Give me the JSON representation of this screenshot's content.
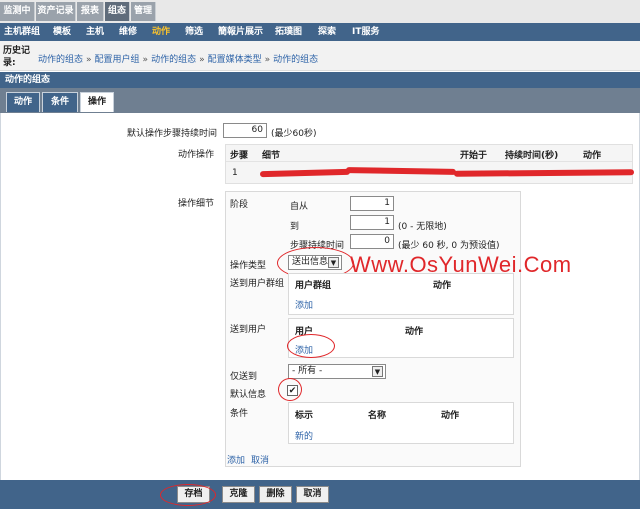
{
  "topnav": {
    "tabs": [
      {
        "label": "监测中"
      },
      {
        "label": "资产记录"
      },
      {
        "label": "报表"
      },
      {
        "label": "组态",
        "active": true
      },
      {
        "label": "管理"
      }
    ]
  },
  "subnav": {
    "items": [
      {
        "label": "主机群组"
      },
      {
        "label": "模板"
      },
      {
        "label": "主机"
      },
      {
        "label": "维修"
      },
      {
        "label": "动作",
        "active": true
      },
      {
        "label": "筛选"
      },
      {
        "label": "簡報片展示"
      },
      {
        "label": "拓璞图"
      },
      {
        "label": "探索"
      },
      {
        "label": "IT服务"
      }
    ]
  },
  "history": {
    "label": "历史记录:",
    "crumbs": [
      "动作的组态",
      "配置用户组",
      "动作的组态",
      "配置媒体类型",
      "动作的组态"
    ],
    "separator": "»"
  },
  "section_title": "动作的组态",
  "tabs": [
    {
      "label": "动作"
    },
    {
      "label": "条件"
    },
    {
      "label": "操作",
      "active": true
    }
  ],
  "form": {
    "default_step_duration": {
      "label": "默认操作步骤持续时间",
      "value": "60",
      "hint": "(最少60秒)"
    },
    "operations": {
      "label": "动作操作",
      "headers": {
        "step": "步骤",
        "detail": "细节",
        "start": "开始于",
        "duration": "持续时间(秒)",
        "action": "动作"
      },
      "row": {
        "step": "1"
      }
    },
    "op_details": {
      "label": "操作细节",
      "stage": {
        "label": "阶段",
        "from_label": "自从",
        "from_value": "1",
        "to_label": "到",
        "to_value": "1",
        "to_hint": "(0 - 无限地)",
        "duration_label": "步骤持续时间",
        "duration_value": "0",
        "duration_hint": "(最少 60 秒, 0 为预设值)"
      },
      "op_type": {
        "label": "操作类型",
        "value": "送出信息"
      },
      "send_to_groups": {
        "label": "送到用户群组",
        "col_group": "用户群组",
        "col_action": "动作",
        "add": "添加"
      },
      "send_to_users": {
        "label": "送到用户",
        "col_user": "用户",
        "col_action": "动作",
        "add": "添加"
      },
      "send_only_to": {
        "label": "仅送到",
        "value": "- 所有 -"
      },
      "default_message": {
        "label": "默认信息",
        "checked": true,
        "check_glyph": "✔"
      },
      "conditions": {
        "label": "条件",
        "col_label": "标示",
        "col_name": "名称",
        "col_action": "动作",
        "new": "新的"
      },
      "footer": {
        "add": "添加",
        "cancel": "取消"
      }
    }
  },
  "watermark": "Www.OsYunWei.Com",
  "buttons": {
    "save": "存档",
    "clone": "克隆",
    "delete": "删除",
    "cancel": "取消"
  },
  "colors": {
    "nav_blue": "#41648a",
    "active_yellow": "#f9c22e",
    "annotation_red": "#e0272a",
    "link_blue": "#2f64a8"
  }
}
